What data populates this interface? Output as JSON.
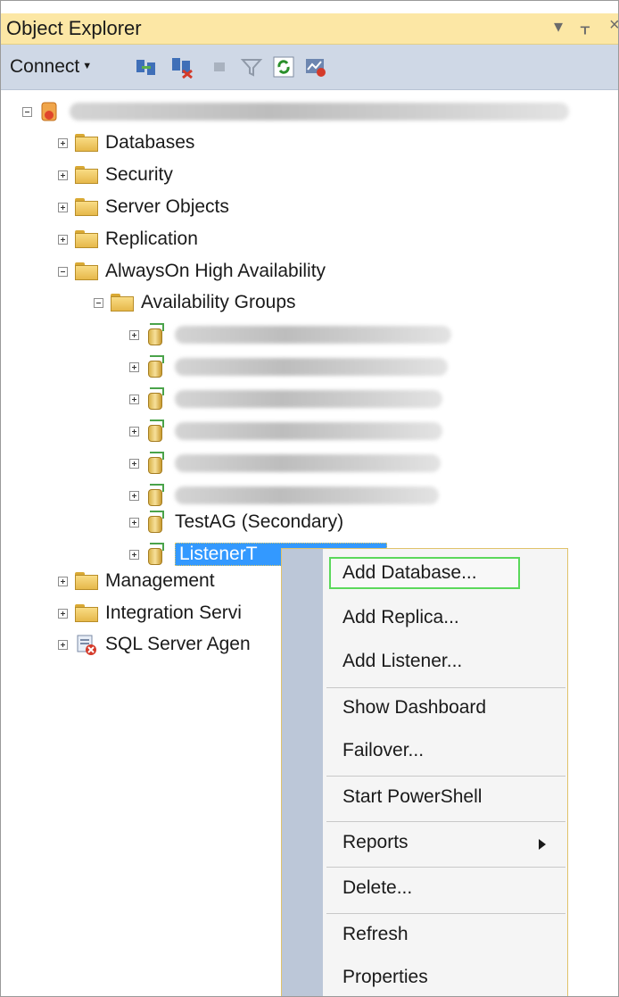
{
  "panel": {
    "title": "Object Explorer",
    "title_controls": [
      "▾",
      "ᚁ",
      "×"
    ],
    "toolbar": {
      "connect_label": "Connect",
      "icons": [
        "connect-object-explorer-icon",
        "disconnect-icon",
        "stop-icon",
        "filter-icon",
        "refresh-icon",
        "activity-monitor-icon"
      ]
    }
  },
  "tree": {
    "nodes": [
      {
        "label": "Databases"
      },
      {
        "label": "Security"
      },
      {
        "label": "Server Objects"
      },
      {
        "label": "Replication"
      },
      {
        "label": "AlwaysOn High Availability"
      },
      {
        "label": "Availability Groups"
      },
      {
        "label": "TestAG (Secondary)"
      },
      {
        "label": "ListenerT"
      },
      {
        "label": "Management"
      },
      {
        "label": "Integration Servi"
      },
      {
        "label": "SQL Server Agen"
      }
    ]
  },
  "context_menu": {
    "items": [
      {
        "label": "Add Database..."
      },
      {
        "label": "Add Replica..."
      },
      {
        "label": "Add Listener..."
      },
      {
        "label": "Show Dashboard"
      },
      {
        "label": "Failover..."
      },
      {
        "label": "Start PowerShell"
      },
      {
        "label": "Reports"
      },
      {
        "label": "Delete..."
      },
      {
        "label": "Refresh"
      },
      {
        "label": "Properties"
      }
    ]
  }
}
